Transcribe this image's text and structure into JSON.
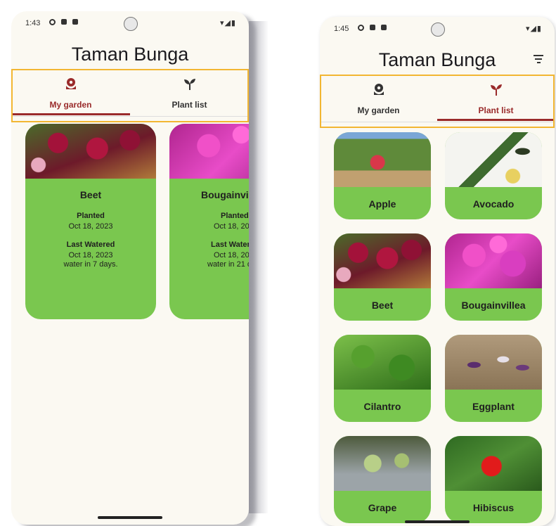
{
  "left_screen": {
    "status": {
      "time": "1:43"
    },
    "app_title": "Taman Bunga",
    "tabs": [
      {
        "label": "My garden",
        "icon": "flower-icon",
        "active": true
      },
      {
        "label": "Plant list",
        "icon": "sprout-icon",
        "active": false
      }
    ],
    "garden_cards": [
      {
        "name": "Beet",
        "planted_label": "Planted",
        "planted_date": "Oct 18, 2023",
        "watered_label": "Last Watered",
        "watered_date": "Oct 18, 2023",
        "water_note": "water in 7 days."
      },
      {
        "name": "Bougainvi",
        "planted_label": "Planted",
        "planted_date": "Oct 18, 202",
        "watered_label": "Last Water",
        "watered_date": "Oct 18, 202",
        "water_note": "water in 21 d"
      }
    ]
  },
  "right_screen": {
    "status": {
      "time": "1:45"
    },
    "app_title": "Taman Bunga",
    "tabs": [
      {
        "label": "My garden",
        "icon": "flower-icon",
        "active": false
      },
      {
        "label": "Plant list",
        "icon": "sprout-icon",
        "active": true
      }
    ],
    "plants": [
      "Apple",
      "Avocado",
      "Beet",
      "Bougainvillea",
      "Cilantro",
      "Eggplant",
      "Grape",
      "Hibiscus"
    ]
  },
  "colors": {
    "accent": "#9a2b2b",
    "card_green": "#7ac74f",
    "background": "#fbf9f2",
    "highlight": "#f2b632"
  }
}
